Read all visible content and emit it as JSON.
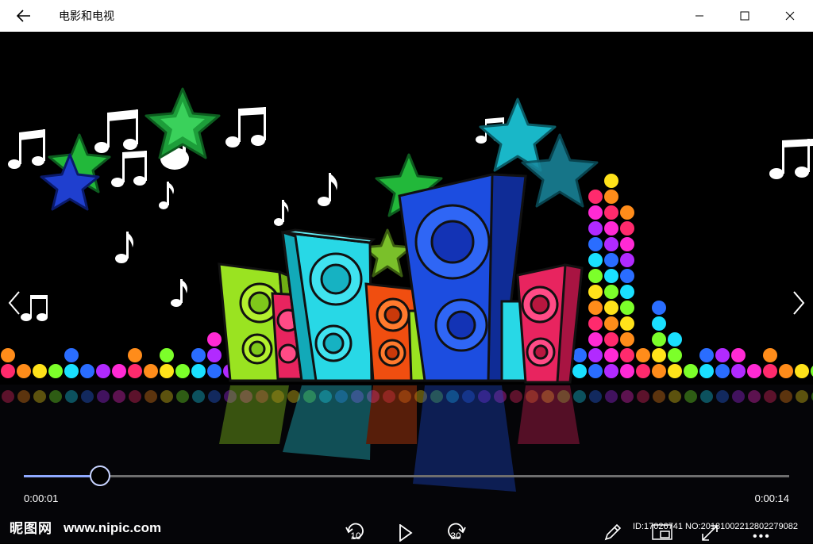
{
  "app": {
    "title": "电影和电视"
  },
  "window_controls": [
    "minimize",
    "maximize",
    "close"
  ],
  "player": {
    "current_time": "0:00:01",
    "duration": "0:00:14",
    "progress_fraction": 0.1,
    "skip_back_seconds": "10",
    "skip_forward_seconds": "30"
  },
  "watermark": {
    "logo": "昵图网",
    "site": "www.nipic.com",
    "id_text": "ID:17026741 NO:20181002212802279082"
  },
  "icons": {
    "back": "back-arrow-icon",
    "prev": "chevron-left-icon",
    "next": "chevron-right-icon",
    "skip_back": "skip-back-10-icon",
    "play": "play-icon",
    "skip_forward": "skip-forward-30-icon",
    "edit": "pencil-icon",
    "mini_view": "mini-view-icon",
    "fullscreen": "fullscreen-icon",
    "more": "more-icon"
  },
  "colors": {
    "progress_fill": "#8fa9ff",
    "progress_track": "#6e6e6e",
    "titlebar_bg": "#ffffff"
  }
}
